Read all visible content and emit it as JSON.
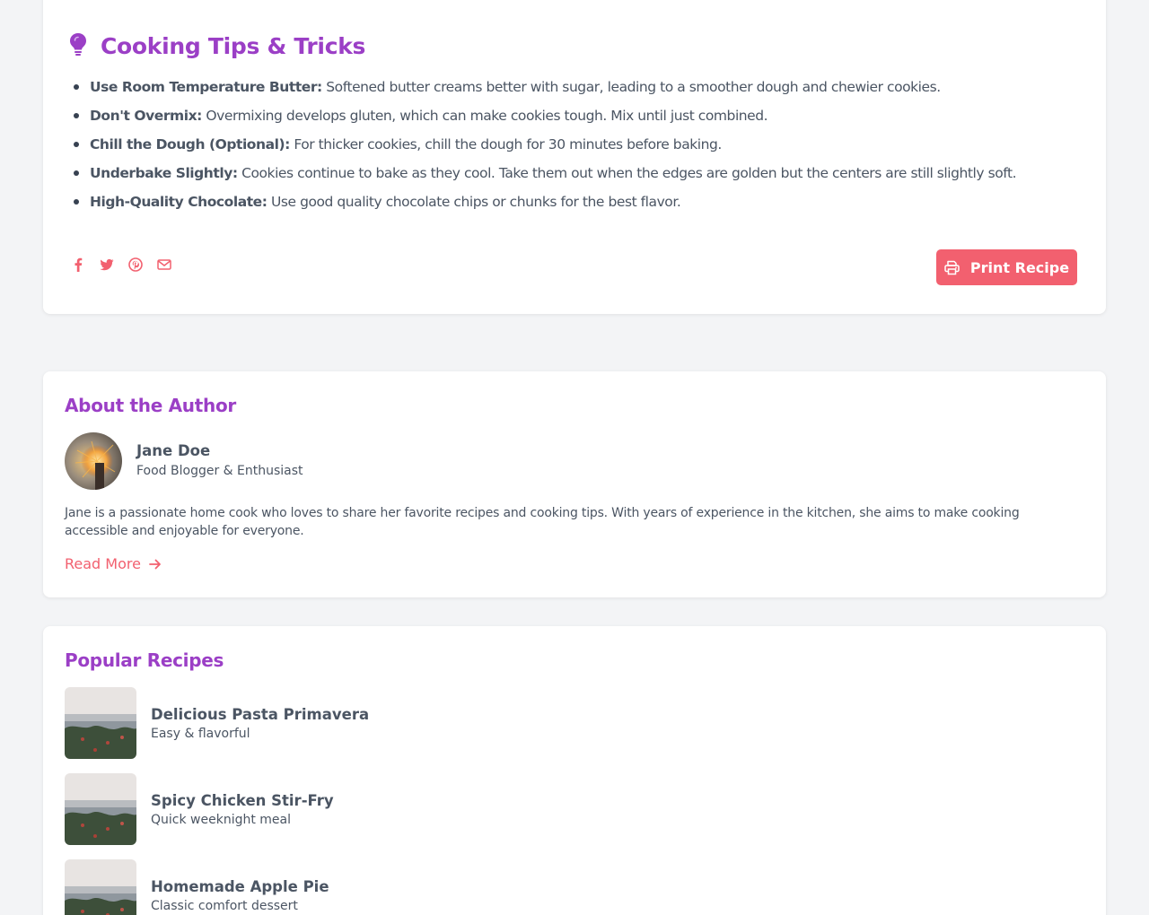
{
  "tips": {
    "title": "Cooking Tips & Tricks",
    "icon": "lightbulb-icon",
    "items": [
      {
        "label": "Use Room Temperature Butter:",
        "text": "Softened butter creams better with sugar, leading to a smoother dough and chewier cookies."
      },
      {
        "label": "Don't Overmix:",
        "text": "Overmixing develops gluten, which can make cookies tough. Mix until just combined."
      },
      {
        "label": "Chill the Dough (Optional):",
        "text": "For thicker cookies, chill the dough for 30 minutes before baking."
      },
      {
        "label": "Underbake Slightly:",
        "text": "Cookies continue to bake as they cool. Take them out when the edges are golden but the centers are still slightly soft."
      },
      {
        "label": "High-Quality Chocolate:",
        "text": "Use good quality chocolate chips or chunks for the best flavor."
      }
    ],
    "share_icons": [
      "facebook-icon",
      "twitter-icon",
      "pinterest-icon",
      "envelope-icon"
    ],
    "print_label": "Print Recipe"
  },
  "author": {
    "section_title": "About the Author",
    "name": "Jane Doe",
    "role": "Food Blogger & Enthusiast",
    "bio": "Jane is a passionate home cook who loves to share her favorite recipes and cooking tips. With years of experience in the kitchen, she aims to make cooking accessible and enjoyable for everyone.",
    "read_more": "Read More"
  },
  "popular": {
    "section_title": "Popular Recipes",
    "recipes": [
      {
        "name": "Delicious Pasta Primavera",
        "subtitle": "Easy & flavorful"
      },
      {
        "name": "Spicy Chicken Stir-Fry",
        "subtitle": "Quick weeknight meal"
      },
      {
        "name": "Homemade Apple Pie",
        "subtitle": "Classic comfort dessert"
      }
    ]
  },
  "colors": {
    "accent_purple": "#9b3fc6",
    "accent_coral": "#f2606f",
    "text": "#4b5563",
    "background": "#f3f4f6"
  }
}
